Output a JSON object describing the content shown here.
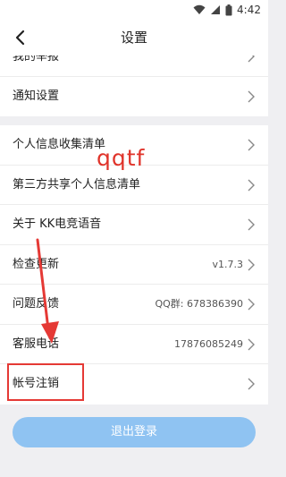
{
  "status_bar": {
    "time": "4:42",
    "icons": [
      "wifi-icon",
      "signal-icon",
      "battery-icon"
    ]
  },
  "header": {
    "title": "设置",
    "back_icon": "back-chevron-icon"
  },
  "top_group": {
    "items": [
      {
        "label": "我的举报",
        "partial": true
      },
      {
        "label": "通知设置"
      }
    ]
  },
  "main_group": {
    "items": [
      {
        "label": "个人信息收集清单",
        "value": ""
      },
      {
        "label": "第三方共享个人信息清单",
        "value": ""
      },
      {
        "label": "关于 KK电竞语音",
        "value": ""
      },
      {
        "label": "检查更新",
        "value": "v1.7.3"
      },
      {
        "label": "问题反馈",
        "value": "QQ群: 678386390"
      },
      {
        "label": "客服电话",
        "value": "17876085249"
      },
      {
        "label": "帐号注销",
        "value": ""
      }
    ]
  },
  "logout": {
    "label": "退出登录"
  },
  "annotation": {
    "watermark_text": "qqtf"
  },
  "colors": {
    "page_background": "#efeff2",
    "logout_button": "#8fc3f2",
    "annotation_red": "#e53935",
    "watermark_red": "#e0332a"
  }
}
